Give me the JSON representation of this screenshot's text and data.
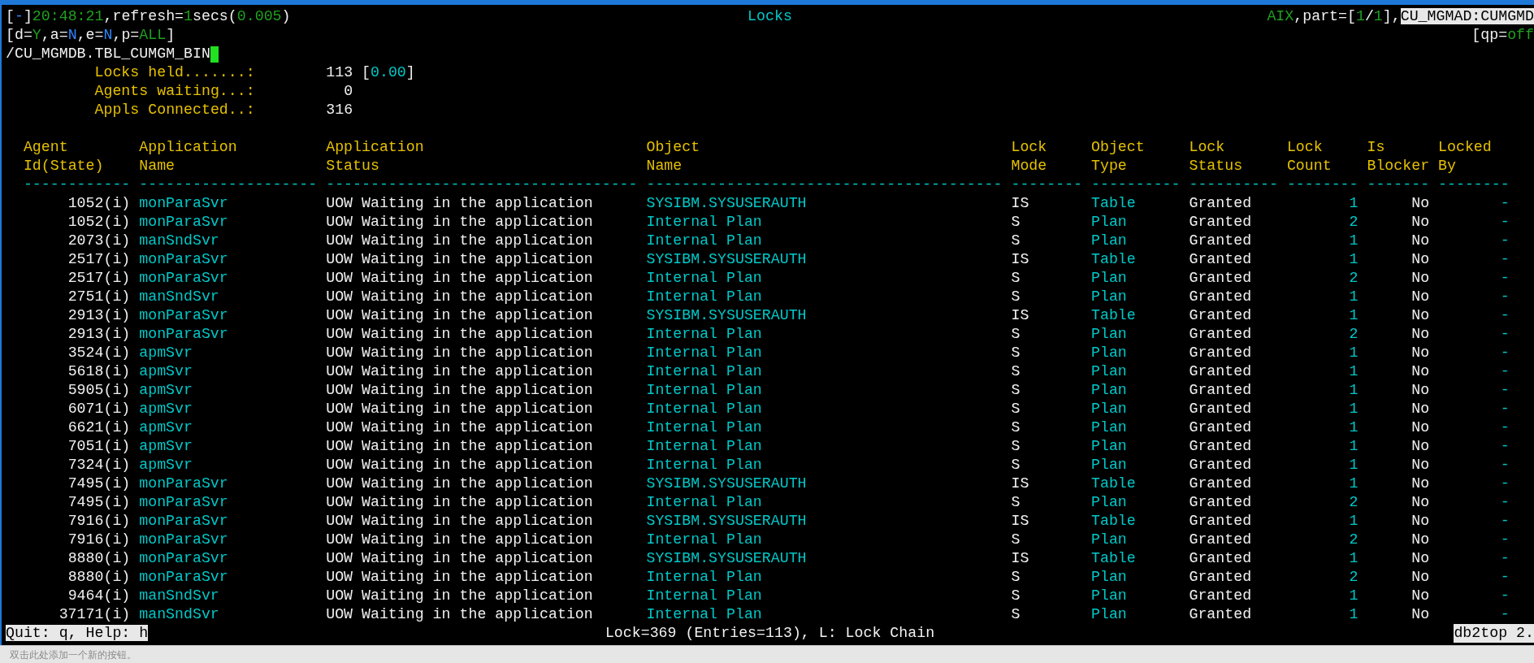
{
  "header": {
    "left": [
      {
        "text": "[",
        "kind": "plain"
      },
      {
        "text": "-",
        "kind": "flag"
      },
      {
        "text": "]",
        "kind": "plain"
      },
      {
        "text": "20:48:21",
        "kind": "value"
      },
      {
        "text": ",refresh=",
        "kind": "plain"
      },
      {
        "text": "1",
        "kind": "value"
      },
      {
        "text": "secs(",
        "kind": "plain"
      },
      {
        "text": "0.005",
        "kind": "value"
      },
      {
        "text": ")",
        "kind": "plain"
      }
    ],
    "title": "Locks",
    "right": [
      {
        "text": "AIX",
        "kind": "value"
      },
      {
        "text": ",part=[",
        "kind": "plain"
      },
      {
        "text": "1",
        "kind": "value"
      },
      {
        "text": "/",
        "kind": "plain"
      },
      {
        "text": "1",
        "kind": "value"
      },
      {
        "text": "],",
        "kind": "plain"
      },
      {
        "text": "CU_MGMAD:CUMGMD",
        "kind": "inverse"
      }
    ],
    "options": [
      {
        "text": "[d=",
        "kind": "plain"
      },
      {
        "text": "Y",
        "kind": "value"
      },
      {
        "text": ",a=",
        "kind": "plain"
      },
      {
        "text": "N",
        "kind": "flag"
      },
      {
        "text": ",e=",
        "kind": "plain"
      },
      {
        "text": "N",
        "kind": "flag"
      },
      {
        "text": ",p=",
        "kind": "plain"
      },
      {
        "text": "ALL",
        "kind": "value"
      },
      {
        "text": "]",
        "kind": "plain"
      }
    ],
    "options_right": [
      {
        "text": "[qp=",
        "kind": "plain"
      },
      {
        "text": "off",
        "kind": "value"
      }
    ],
    "command": "/CU_MGMDB.TBL_CUMGM_BIN"
  },
  "summary": [
    {
      "label": "Locks held.......:",
      "value": "113",
      "rate": [
        {
          "text": "[",
          "kind": "plain"
        },
        {
          "text": "0.00",
          "kind": "cyan"
        },
        {
          "text": "]",
          "kind": "plain"
        }
      ]
    },
    {
      "label": "Agents waiting...:",
      "value": "0"
    },
    {
      "label": "Appls Connected..:",
      "value": "316"
    }
  ],
  "table": {
    "columns": [
      {
        "lines": [
          "Agent",
          "Id(State)"
        ],
        "rule": "------------",
        "kind": "id"
      },
      {
        "lines": [
          "Application",
          "Name"
        ],
        "rule": "--------------------",
        "kind": "name"
      },
      {
        "lines": [
          "Application",
          "Status"
        ],
        "rule": "-----------------------------------",
        "kind": "text"
      },
      {
        "lines": [
          "Object",
          "Name"
        ],
        "rule": "----------------------------------------",
        "kind": "name"
      },
      {
        "lines": [
          "Lock",
          "Mode"
        ],
        "rule": "--------",
        "kind": "text"
      },
      {
        "lines": [
          "Object",
          "Type"
        ],
        "rule": "----------",
        "kind": "name"
      },
      {
        "lines": [
          "Lock",
          "Status"
        ],
        "rule": "----------",
        "kind": "text"
      },
      {
        "lines": [
          "Lock",
          "Count"
        ],
        "rule": "--------",
        "kind": "count"
      },
      {
        "lines": [
          "Is",
          "Blocker"
        ],
        "rule": "-------",
        "kind": "flag"
      },
      {
        "lines": [
          "Locked",
          "By"
        ],
        "rule": "--------",
        "kind": "count"
      }
    ],
    "rows": [
      [
        "1052(i)",
        "monParaSvr",
        "UOW Waiting in the application",
        "SYSIBM.SYSUSERAUTH",
        "IS",
        "Table",
        "Granted",
        "1",
        "No",
        "-"
      ],
      [
        "1052(i)",
        "monParaSvr",
        "UOW Waiting in the application",
        "Internal Plan",
        "S",
        "Plan",
        "Granted",
        "2",
        "No",
        "-"
      ],
      [
        "2073(i)",
        "manSndSvr",
        "UOW Waiting in the application",
        "Internal Plan",
        "S",
        "Plan",
        "Granted",
        "1",
        "No",
        "-"
      ],
      [
        "2517(i)",
        "monParaSvr",
        "UOW Waiting in the application",
        "SYSIBM.SYSUSERAUTH",
        "IS",
        "Table",
        "Granted",
        "1",
        "No",
        "-"
      ],
      [
        "2517(i)",
        "monParaSvr",
        "UOW Waiting in the application",
        "Internal Plan",
        "S",
        "Plan",
        "Granted",
        "2",
        "No",
        "-"
      ],
      [
        "2751(i)",
        "manSndSvr",
        "UOW Waiting in the application",
        "Internal Plan",
        "S",
        "Plan",
        "Granted",
        "1",
        "No",
        "-"
      ],
      [
        "2913(i)",
        "monParaSvr",
        "UOW Waiting in the application",
        "SYSIBM.SYSUSERAUTH",
        "IS",
        "Table",
        "Granted",
        "1",
        "No",
        "-"
      ],
      [
        "2913(i)",
        "monParaSvr",
        "UOW Waiting in the application",
        "Internal Plan",
        "S",
        "Plan",
        "Granted",
        "2",
        "No",
        "-"
      ],
      [
        "3524(i)",
        "apmSvr",
        "UOW Waiting in the application",
        "Internal Plan",
        "S",
        "Plan",
        "Granted",
        "1",
        "No",
        "-"
      ],
      [
        "5618(i)",
        "apmSvr",
        "UOW Waiting in the application",
        "Internal Plan",
        "S",
        "Plan",
        "Granted",
        "1",
        "No",
        "-"
      ],
      [
        "5905(i)",
        "apmSvr",
        "UOW Waiting in the application",
        "Internal Plan",
        "S",
        "Plan",
        "Granted",
        "1",
        "No",
        "-"
      ],
      [
        "6071(i)",
        "apmSvr",
        "UOW Waiting in the application",
        "Internal Plan",
        "S",
        "Plan",
        "Granted",
        "1",
        "No",
        "-"
      ],
      [
        "6621(i)",
        "apmSvr",
        "UOW Waiting in the application",
        "Internal Plan",
        "S",
        "Plan",
        "Granted",
        "1",
        "No",
        "-"
      ],
      [
        "7051(i)",
        "apmSvr",
        "UOW Waiting in the application",
        "Internal Plan",
        "S",
        "Plan",
        "Granted",
        "1",
        "No",
        "-"
      ],
      [
        "7324(i)",
        "apmSvr",
        "UOW Waiting in the application",
        "Internal Plan",
        "S",
        "Plan",
        "Granted",
        "1",
        "No",
        "-"
      ],
      [
        "7495(i)",
        "monParaSvr",
        "UOW Waiting in the application",
        "SYSIBM.SYSUSERAUTH",
        "IS",
        "Table",
        "Granted",
        "1",
        "No",
        "-"
      ],
      [
        "7495(i)",
        "monParaSvr",
        "UOW Waiting in the application",
        "Internal Plan",
        "S",
        "Plan",
        "Granted",
        "2",
        "No",
        "-"
      ],
      [
        "7916(i)",
        "monParaSvr",
        "UOW Waiting in the application",
        "SYSIBM.SYSUSERAUTH",
        "IS",
        "Table",
        "Granted",
        "1",
        "No",
        "-"
      ],
      [
        "7916(i)",
        "monParaSvr",
        "UOW Waiting in the application",
        "Internal Plan",
        "S",
        "Plan",
        "Granted",
        "2",
        "No",
        "-"
      ],
      [
        "8880(i)",
        "monParaSvr",
        "UOW Waiting in the application",
        "SYSIBM.SYSUSERAUTH",
        "IS",
        "Table",
        "Granted",
        "1",
        "No",
        "-"
      ],
      [
        "8880(i)",
        "monParaSvr",
        "UOW Waiting in the application",
        "Internal Plan",
        "S",
        "Plan",
        "Granted",
        "2",
        "No",
        "-"
      ],
      [
        "9464(i)",
        "manSndSvr",
        "UOW Waiting in the application",
        "Internal Plan",
        "S",
        "Plan",
        "Granted",
        "1",
        "No",
        "-"
      ],
      [
        "37171(i)",
        "manSndSvr",
        "UOW Waiting in the application",
        "Internal Plan",
        "S",
        "Plan",
        "Granted",
        "1",
        "No",
        "-"
      ]
    ]
  },
  "status_bar": {
    "help": "Quit: q, Help: h",
    "info": "Lock=369 (Entries=113), L: Lock Chain",
    "version": "db2top 2."
  },
  "button_bar": {
    "hint": "双击此处添加一个新的按钮。"
  }
}
